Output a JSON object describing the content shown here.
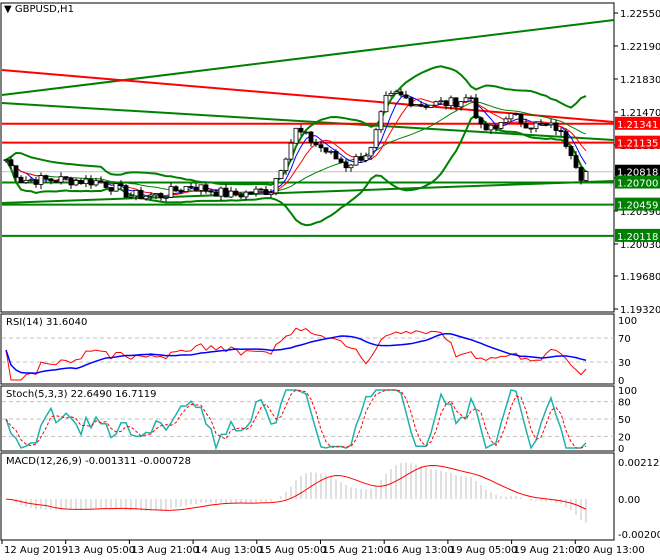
{
  "window": {
    "title": "GBPUSD,H1"
  },
  "chart_data": [
    {
      "type": "candlestick",
      "title": "GBPUSD,H1",
      "ylim": [
        1.1932,
        1.2255
      ],
      "y_ticks": [
        "1.22550",
        "1.22190",
        "1.21830",
        "1.21470",
        "1.21110",
        "1.20750",
        "1.20390",
        "1.20030",
        "1.19680",
        "1.19320"
      ],
      "price_labels": [
        {
          "text": "1.21341",
          "value": 1.21341,
          "color": "#ff0000"
        },
        {
          "text": "1.21135",
          "value": 1.21135,
          "color": "#ff0000"
        },
        {
          "text": "1.20818",
          "value": 1.20818,
          "color": "#000000"
        },
        {
          "text": "1.20700",
          "value": 1.207,
          "color": "#008000"
        },
        {
          "text": "1.20459",
          "value": 1.20459,
          "color": "#008000"
        },
        {
          "text": "1.20118",
          "value": 1.20118,
          "color": "#008000"
        }
      ],
      "key_closes": [
        [
          0,
          1.2095
        ],
        [
          3,
          1.2073
        ],
        [
          11,
          1.2073
        ],
        [
          19,
          1.2071
        ],
        [
          25,
          1.2056
        ],
        [
          31,
          1.2056
        ],
        [
          37,
          1.2067
        ],
        [
          45,
          1.2056
        ],
        [
          53,
          1.2062
        ],
        [
          58,
          1.2127
        ],
        [
          61,
          1.2116
        ],
        [
          65,
          1.21
        ],
        [
          68,
          1.2089
        ],
        [
          73,
          1.2105
        ],
        [
          76,
          1.216
        ],
        [
          78,
          1.2166
        ],
        [
          83,
          1.2155
        ],
        [
          89,
          1.2157
        ],
        [
          93,
          1.2163
        ],
        [
          95,
          1.2128
        ],
        [
          98,
          1.2128
        ],
        [
          100,
          1.2144
        ],
        [
          105,
          1.2133
        ],
        [
          110,
          1.213
        ],
        [
          113,
          1.2105
        ],
        [
          115,
          1.2078
        ],
        [
          116,
          1.2082
        ]
      ]
    },
    {
      "type": "line",
      "title": "RSI(14) 31.6040",
      "ylim": [
        0,
        100
      ],
      "y_ticks": [
        "100",
        "70",
        "30",
        "0"
      ],
      "levels": [
        70,
        30
      ]
    },
    {
      "type": "line",
      "title": "Stoch(5,3,3) 22.6490 16.7119",
      "ylim": [
        0,
        100
      ],
      "y_ticks": [
        "100",
        "80",
        "50",
        "20",
        "0"
      ],
      "levels": [
        80,
        50,
        20
      ]
    },
    {
      "type": "bar",
      "title": "MACD(12,26,9) -0.001311 -0.000728",
      "ylim": [
        -0.002003,
        0.002127
      ],
      "y_ticks": [
        "0.002127",
        "0.00",
        "-0.002003"
      ]
    }
  ],
  "time_axis": [
    "12 Aug 2019",
    "13 Aug 05:00",
    "13 Aug 21:00",
    "14 Aug 13:00",
    "15 Aug 05:00",
    "15 Aug 21:00",
    "16 Aug 13:00",
    "19 Aug 05:00",
    "19 Aug 21:00",
    "20 Aug 13:00"
  ],
  "colors": {
    "bull": "#000000",
    "bear": "#000000",
    "up_line": "#008000",
    "support": "#008000",
    "resistance": "#ff0000",
    "rsi": "#ff0000",
    "rsi_ma": "#0000ff",
    "stoch_main": "#20b2aa",
    "stoch_signal": "#ff0000",
    "macd": "#c0c0c0",
    "macd_signal": "#ff0000"
  }
}
